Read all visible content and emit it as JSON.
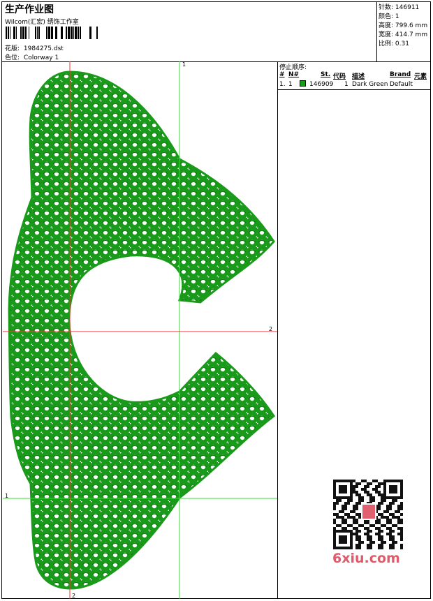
{
  "header": {
    "title": "生产作业图",
    "subtitle": "Wilcom(汇宏) 绣饰工作室",
    "design_label": "花版:",
    "design_value": "1984275.dst",
    "colorway_label": "色位:",
    "colorway_value": "Colorway 1"
  },
  "stats": {
    "stitches_label": "针数:",
    "stitches_value": "146911",
    "colors_label": "颜色:",
    "colors_value": "1",
    "height_label": "高度:",
    "height_value": "799.6 mm",
    "width_label": "宽度:",
    "width_value": "414.7 mm",
    "scale_label": "比例:",
    "scale_value": "0.31"
  },
  "stop_sequence": {
    "title": "停止顺序:",
    "headers": [
      "#",
      "N#",
      "St.",
      "代码",
      "描述",
      "Brand",
      "元素"
    ],
    "rows": [
      {
        "index": "1.",
        "n": "1",
        "stitches": "146909",
        "code": "1",
        "description": "Dark Green",
        "brand": "Default",
        "element": ""
      }
    ]
  },
  "guides": {
    "v1_label": "1",
    "h2_label": "2",
    "h1_label": "1",
    "v2_label": "2"
  },
  "colors": {
    "thread": "#1a9a1a",
    "guide_green": "#33dd33",
    "guide_red": "#ff3333"
  },
  "watermark": "6xiu.com"
}
